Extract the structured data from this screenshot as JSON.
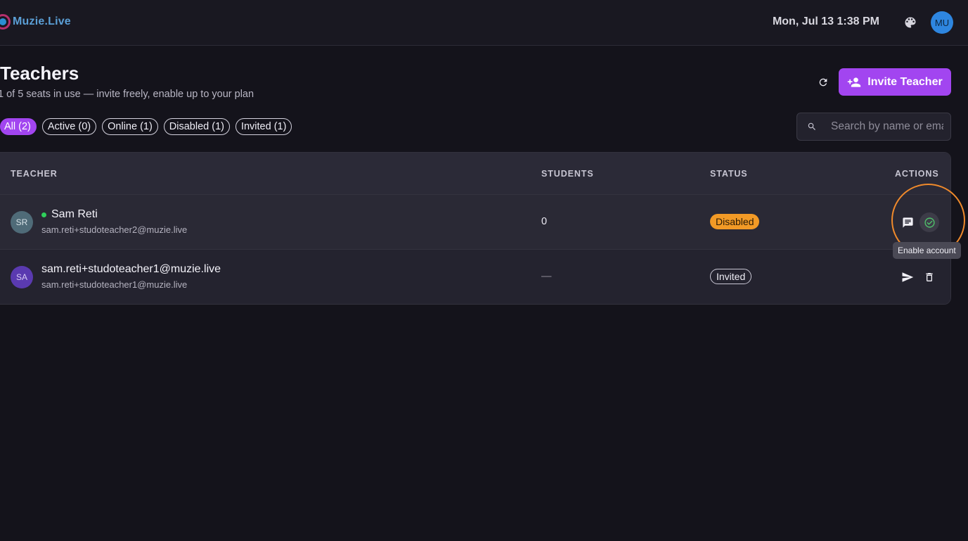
{
  "app": {
    "name": "Muzie.Live"
  },
  "header": {
    "datetime": "Mon, Jul 13 1:38 PM",
    "user_initials": "MU"
  },
  "page": {
    "title": "Teachers",
    "subtitle": "1 of 5 seats in use — invite freely, enable up to your plan",
    "invite_label": "Invite Teacher"
  },
  "filters": [
    {
      "label": "All (2)",
      "active": true
    },
    {
      "label": "Active (0)",
      "active": false
    },
    {
      "label": "Online (1)",
      "active": false
    },
    {
      "label": "Disabled (1)",
      "active": false
    },
    {
      "label": "Invited (1)",
      "active": false
    }
  ],
  "search": {
    "placeholder": "Search by name or email"
  },
  "table": {
    "columns": [
      "TEACHER",
      "STUDENTS",
      "STATUS",
      "ACTIONS"
    ],
    "rows": [
      {
        "initials": "SR",
        "name": "Sam Reti",
        "online": true,
        "email": "sam.reti+studoteacher2@muzie.live",
        "students": "0",
        "status": "Disabled"
      },
      {
        "initials": "SA",
        "name": "sam.reti+studoteacher1@muzie.live",
        "online": false,
        "email": "sam.reti+studoteacher1@muzie.live",
        "students": "—",
        "status": "Invited"
      }
    ]
  },
  "tooltip": {
    "text": "Enable account"
  },
  "colors": {
    "accent": "#a245f0",
    "disabled_badge": "#f29a26",
    "online": "#2fcf5b",
    "highlight": "#f08a2b"
  }
}
